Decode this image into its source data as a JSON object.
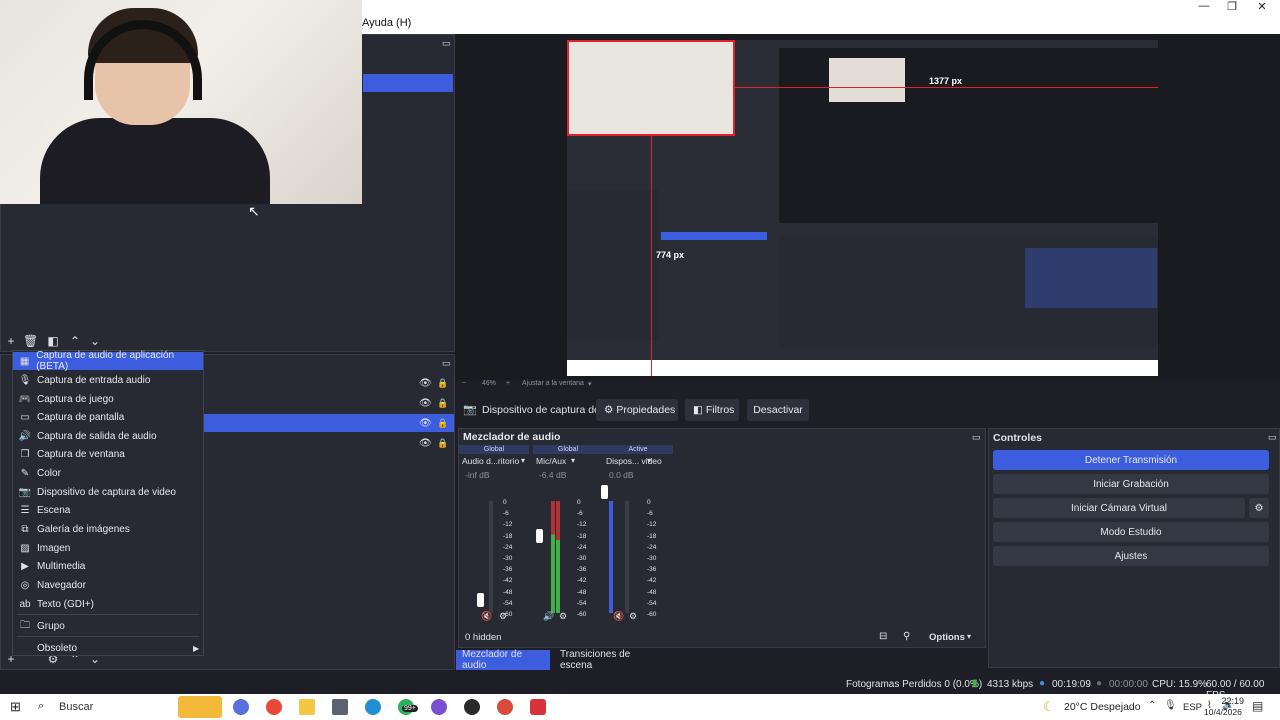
{
  "menubar": {
    "help": "Ayuda (H)"
  },
  "window_controls": {
    "minimize": "—",
    "restore": "❐",
    "close": "✕"
  },
  "preview": {
    "dim1": "1377 px",
    "dim2": "774 px",
    "zoom": "46%",
    "fit": "Ajustar a la ventana"
  },
  "context_menu": {
    "items": [
      {
        "label": "Captura de audio de aplicación (BETA)",
        "icon": "app-audio-icon"
      },
      {
        "label": "Captura de entrada audio",
        "icon": "mic-icon"
      },
      {
        "label": "Captura de juego",
        "icon": "gamepad-icon"
      },
      {
        "label": "Captura de pantalla",
        "icon": "monitor-icon"
      },
      {
        "label": "Captura de salida de audio",
        "icon": "speaker-icon"
      },
      {
        "label": "Captura de ventana",
        "icon": "window-icon"
      },
      {
        "label": "Color",
        "icon": "brush-icon"
      },
      {
        "label": "Dispositivo de captura de video",
        "icon": "camera-icon"
      },
      {
        "label": "Escena",
        "icon": "list-icon"
      },
      {
        "label": "Galería de imágenes",
        "icon": "gallery-icon"
      },
      {
        "label": "Imagen",
        "icon": "image-icon"
      },
      {
        "label": "Multimedia",
        "icon": "play-icon"
      },
      {
        "label": "Navegador",
        "icon": "globe-icon"
      },
      {
        "label": "Texto (GDI+)",
        "icon": "text-icon"
      },
      {
        "label": "Grupo",
        "icon": "folder-icon"
      },
      {
        "label": "Obsoleto",
        "icon": "submenu-icon"
      }
    ]
  },
  "source_toolbar": {
    "name": "Dispositivo de captura de v",
    "properties": "Propiedades",
    "filters": "Filtros",
    "deactivate": "Desactivar"
  },
  "mixer": {
    "title": "Mezclador de audio",
    "channels": [
      {
        "tag": "Global",
        "name": "Audio d...ritorio",
        "db": "-inf dB",
        "level": 0.0
      },
      {
        "tag": "Global",
        "name": "Mic/Aux",
        "db": "-6.4 dB",
        "level": 0.85
      },
      {
        "tag": "Active",
        "name": "Dispos... video",
        "db": "0.0 dB",
        "level": 1.0
      }
    ],
    "scale": [
      "0",
      "-6",
      "-12",
      "-18",
      "-24",
      "-30",
      "-36",
      "-42",
      "-48",
      "-54",
      "-60"
    ],
    "hidden": "0 hidden",
    "options": "Options",
    "tab_mixer": "Mezclador de audio",
    "tab_transitions": "Transiciones de escena"
  },
  "controls": {
    "title": "Controles",
    "stop_stream": "Detener Transmisión",
    "start_recording": "Iniciar Grabación",
    "virtual_cam": "Iniciar Cámara Virtual",
    "studio_mode": "Modo Estudio",
    "settings": "Ajustes"
  },
  "status": {
    "dropped": "Fotogramas Perdidos 0 (0.0%)",
    "bitrate": "4313 kbps",
    "stream_time": "00:19:09",
    "rec_time": "00:00:00",
    "cpu": "CPU: 15.9%",
    "fps": "60.00 / 60.00 FPS"
  },
  "taskbar": {
    "search": "Buscar",
    "weather": "20°C  Despejado",
    "lang": "ESP",
    "time": "22:19",
    "date": "10/4/2026",
    "badge": "99+"
  },
  "colors": {
    "accent": "#3c5ede",
    "panel": "#272a33",
    "bg": "#1e1f26",
    "red": "#e0202a"
  }
}
